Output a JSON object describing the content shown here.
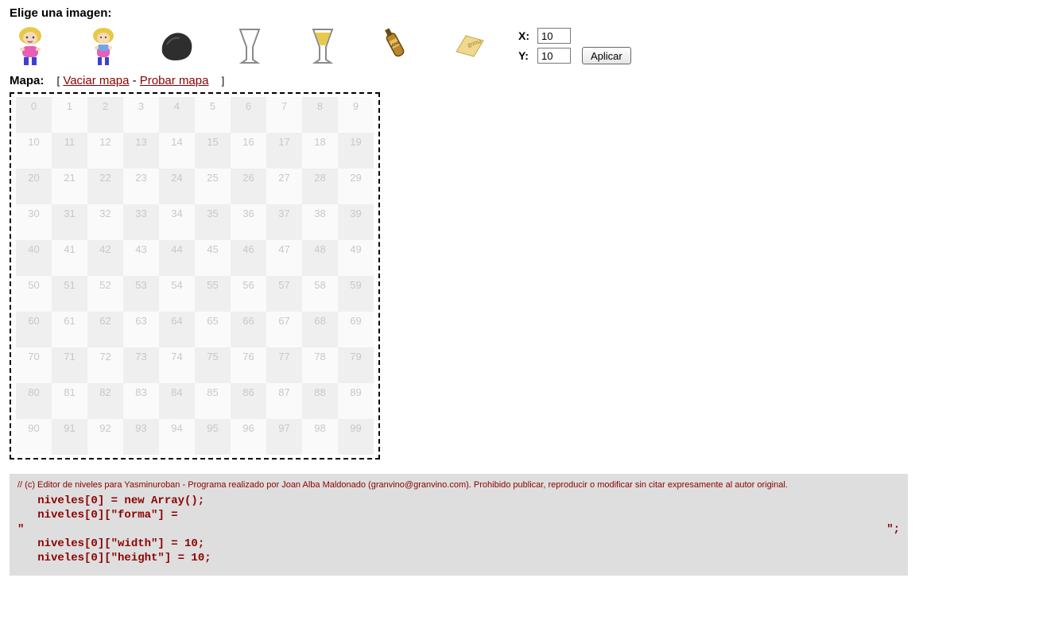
{
  "title": "Elige una imagen:",
  "palette": [
    {
      "name": "girl-pink"
    },
    {
      "name": "girl-blue"
    },
    {
      "name": "rock"
    },
    {
      "name": "glass-empty"
    },
    {
      "name": "glass-full"
    },
    {
      "name": "bottle"
    },
    {
      "name": "eraser"
    }
  ],
  "coords": {
    "xLabel": "X:",
    "yLabel": "Y:",
    "xValue": "10",
    "yValue": "10",
    "apply": "Aplicar"
  },
  "mapHeader": {
    "label": "Mapa:",
    "open": "[",
    "link1": "Vaciar mapa",
    "sep": " - ",
    "link2": "Probar mapa",
    "close": "]"
  },
  "grid": {
    "cols": 10,
    "rows": 10
  },
  "code": {
    "comment": "// (c) Editor de niveles para Yasminuroban - Programa realizado por Joan Alba Maldonado (granvino@granvino.com). Prohibido publicar, reproducir o modificar sin citar expresamente al autor original.",
    "l1": "   niveles[0] = new Array();",
    "l2": "   niveles[0][\"forma\"] =",
    "q1": "\"",
    "q2": "\";",
    "l3": "   niveles[0][\"width\"] = 10;",
    "l4": "   niveles[0][\"height\"] = 10;"
  }
}
